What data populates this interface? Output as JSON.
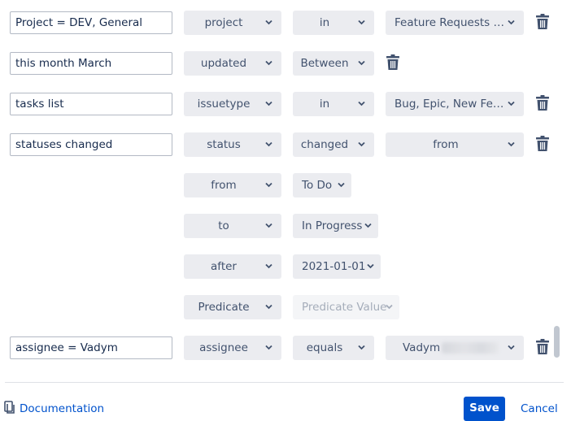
{
  "rows": [
    {
      "input": "Project = DEV, General",
      "field": "project",
      "operator": "in",
      "value": "Feature Requests (F..."
    },
    {
      "input": "this month March",
      "field": "updated",
      "operator": "Between"
    },
    {
      "input": "tasks list",
      "field": "issuetype",
      "operator": "in",
      "value": "Bug, Epic, New Feat..."
    },
    {
      "input": "statuses changed",
      "field": "status",
      "operator": "changed",
      "value": "from"
    },
    {
      "field": "from",
      "operator": "To Do"
    },
    {
      "field": "to",
      "operator": "In Progress"
    },
    {
      "field": "after",
      "operator": "2021-01-01"
    },
    {
      "field": "Predicate",
      "operator": "Predicate Value"
    },
    {
      "input": "assignee = Vadym",
      "field": "assignee",
      "operator": "equals",
      "value": "Vadym"
    }
  ],
  "footer": {
    "documentation": "Documentation",
    "save": "Save",
    "cancel": "Cancel"
  },
  "colors": {
    "accent": "#0052cc",
    "select_bg": "#ebecf0",
    "icon": "#42526e"
  }
}
